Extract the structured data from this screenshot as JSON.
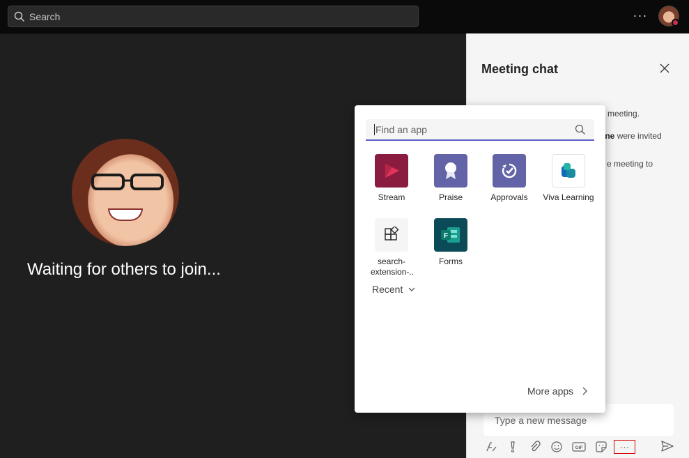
{
  "topbar": {
    "search_placeholder": "Search",
    "more_label": "···"
  },
  "stage": {
    "waiting_text": "Waiting for others to join..."
  },
  "chat": {
    "title": "Meeting chat",
    "lines": [
      "meeting.",
      "were invited",
      "e meeting to"
    ],
    "invited_name": "Cline",
    "compose_placeholder": "Type a new message",
    "toolbar_more_label": "···"
  },
  "popup": {
    "find_placeholder": "Find an app",
    "apps": [
      {
        "label": "Stream",
        "icon": "stream-icon",
        "color": "#8a1c3f"
      },
      {
        "label": "Praise",
        "icon": "praise-icon",
        "color": "#6264a7"
      },
      {
        "label": "Approvals",
        "icon": "approvals-icon",
        "color": "#6264a7"
      },
      {
        "label": "Viva Learning",
        "icon": "viva-learning-icon",
        "color": "#ffffff"
      },
      {
        "label": "search-extension-..",
        "icon": "puzzle-icon",
        "color": "#f5f5f5"
      },
      {
        "label": "Forms",
        "icon": "forms-icon",
        "color": "#0b4a57"
      }
    ],
    "recent_label": "Recent",
    "more_apps_label": "More apps"
  },
  "colors": {
    "accent": "#5b5fc7",
    "stage_bg": "#1f1f1f",
    "status_busy": "#c4314b"
  }
}
